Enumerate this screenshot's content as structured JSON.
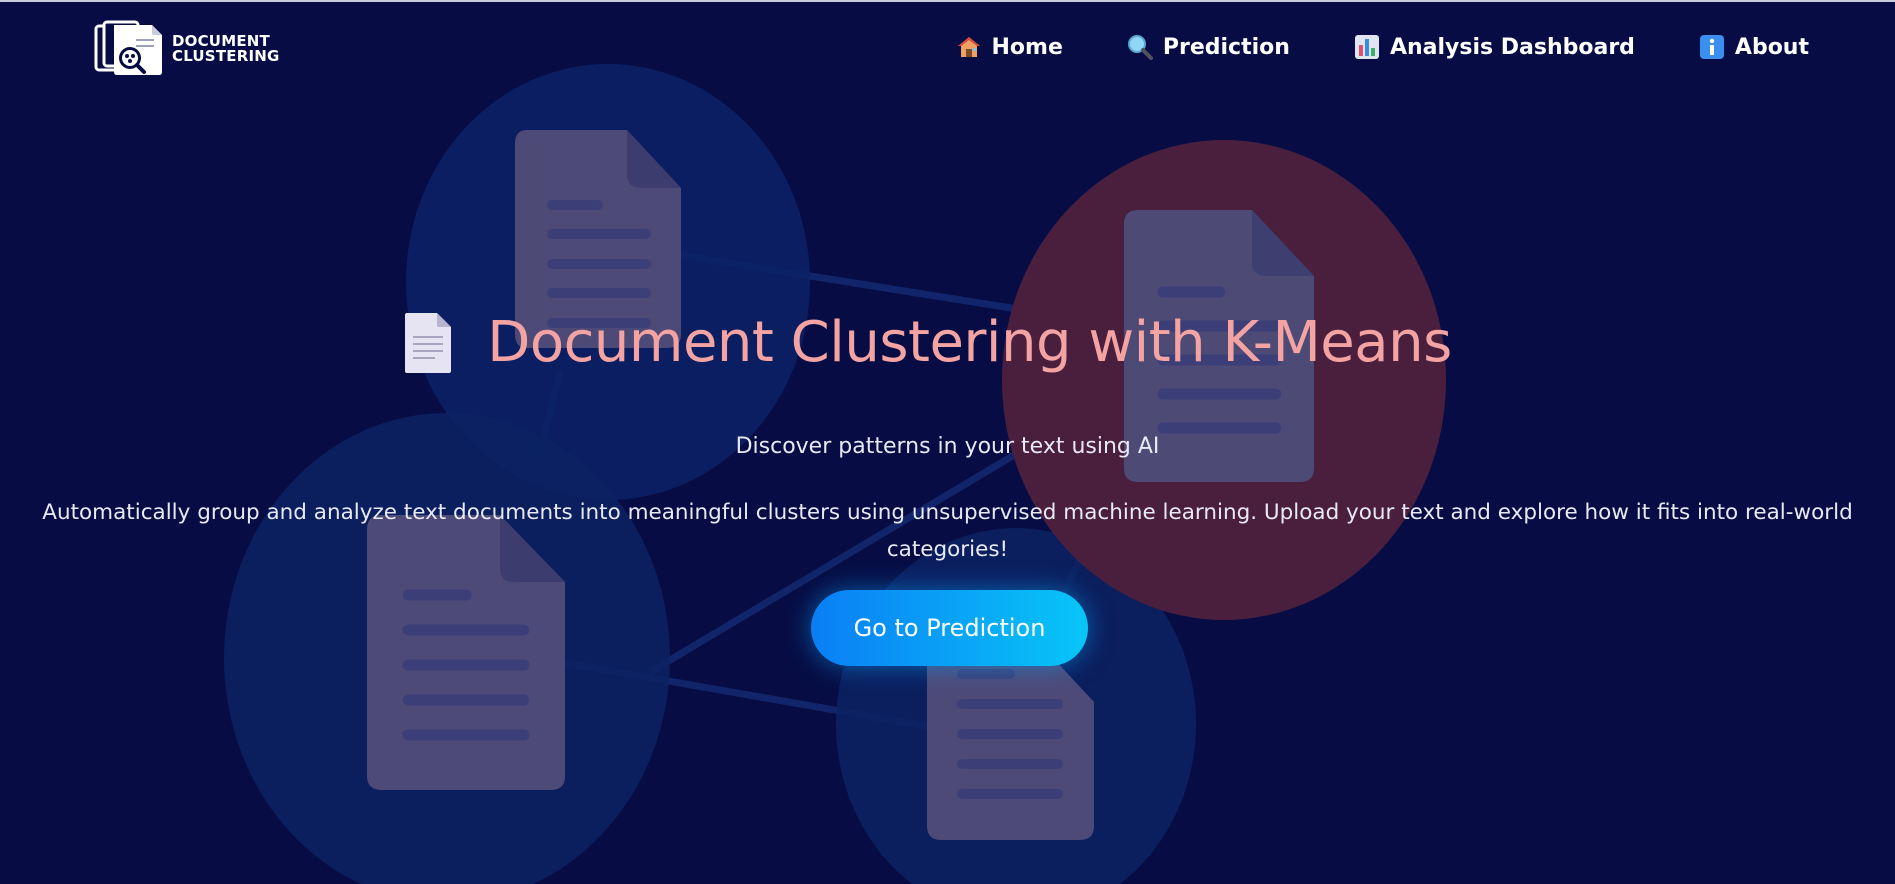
{
  "nav": {
    "logo": {
      "line1": "DOCUMENT",
      "line2": "CLUSTERING",
      "icon": "document-clustering-logo-icon"
    },
    "links": [
      {
        "label": "Home",
        "icon": "house-icon"
      },
      {
        "label": "Prediction",
        "icon": "magnifier-icon"
      },
      {
        "label": "Analysis Dashboard",
        "icon": "bar-chart-icon"
      },
      {
        "label": "About",
        "icon": "info-icon"
      }
    ]
  },
  "hero": {
    "icon": "page-document-icon",
    "title": "Document Clustering with K-Means",
    "subtitle": "Discover patterns in your text using AI",
    "description": "Automatically group and analyze text documents into meaningful clusters using unsupervised machine learning. Upload your text and explore how it fits into real-world categories!",
    "cta_label": "Go to Prediction"
  },
  "colors": {
    "background": "#070d44",
    "title": "#f4a3a3",
    "cta_gradient_start": "#0a7ef5",
    "cta_gradient_end": "#08c6f7"
  }
}
